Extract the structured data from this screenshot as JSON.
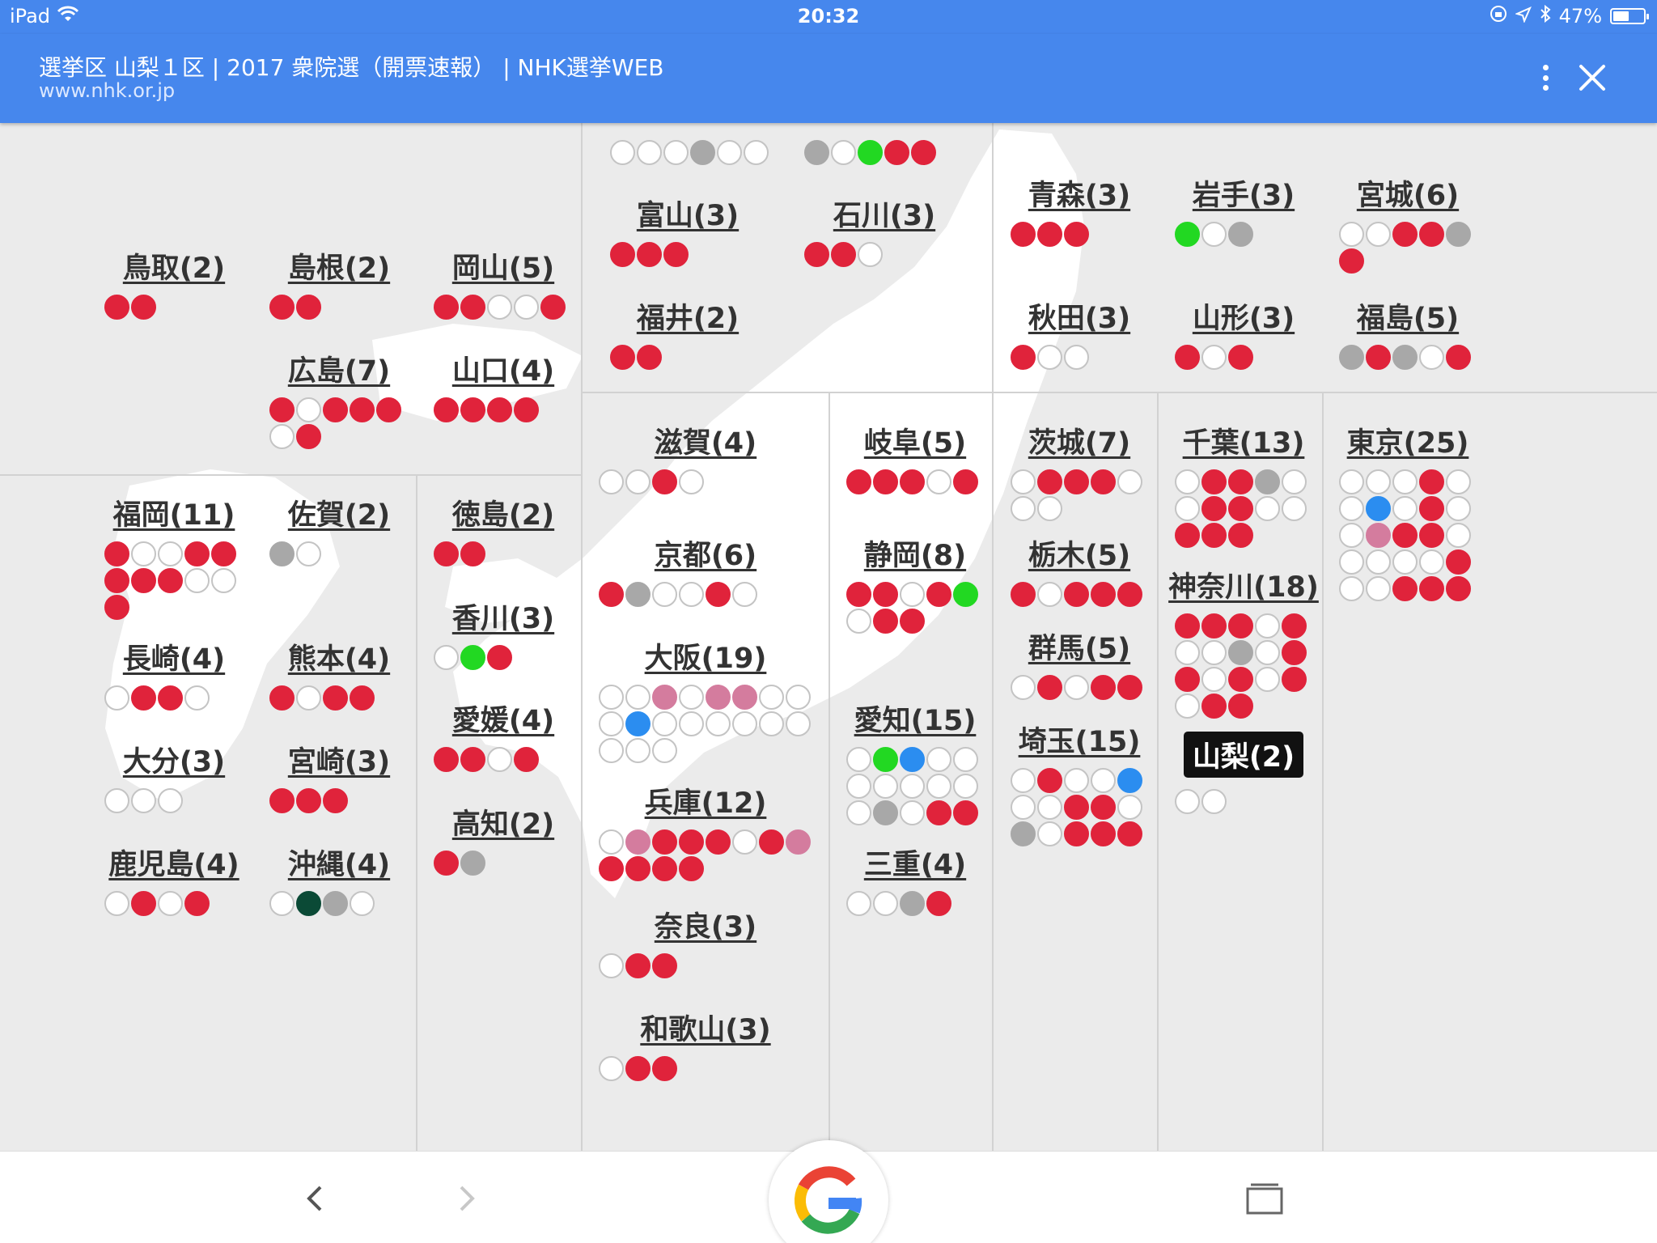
{
  "status": {
    "device": "iPad",
    "time": "20:32",
    "battery_text": "47%",
    "battery_level": 0.47
  },
  "header": {
    "title": "選挙区 山梨１区 | 2017 衆院選（開票速報） | NHK選挙WEB",
    "url": "www.nhk.or.jp"
  },
  "colors": {
    "header_bg": "#4687ed",
    "red": "#e0233b",
    "gray": "#a8a8a8",
    "green": "#22d822",
    "blue": "#2b8df0",
    "pink": "#d47c9e",
    "dark_green": "#0b4a36",
    "white": "#ffffff"
  },
  "dot_legend": {
    "r": "red",
    "g": "gray",
    "G": "green",
    "b": "blue",
    "p": "pink",
    "d": "dark-green",
    "w": "white"
  },
  "icons": {
    "menu": "more-vertical-icon",
    "close": "close-icon",
    "back": "back-arrow-icon",
    "forward": "forward-arrow-icon",
    "google": "google-logo-icon",
    "tabs": "tabs-icon",
    "scroll_top": "chevron-up-icon"
  },
  "prefectures": [
    {
      "id": "partial-1",
      "name": "",
      "dots": "wwwgww"
    },
    {
      "id": "partial-2",
      "name": "",
      "dots": "gwGrr"
    },
    {
      "id": "tottori",
      "name": "鳥取(2)",
      "dots": "rr"
    },
    {
      "id": "shimane",
      "name": "島根(2)",
      "dots": "rr"
    },
    {
      "id": "okayama",
      "name": "岡山(5)",
      "dots": "rrwwr"
    },
    {
      "id": "hiroshima",
      "name": "広島(7)",
      "dots": "rwrrrwr"
    },
    {
      "id": "yamaguchi",
      "name": "山口(4)",
      "dots": "rrrr"
    },
    {
      "id": "fukuoka",
      "name": "福岡(11)",
      "dots": "rwwrrrrrwwr"
    },
    {
      "id": "saga",
      "name": "佐賀(2)",
      "dots": "gw"
    },
    {
      "id": "tokushima",
      "name": "徳島(2)",
      "dots": "rr"
    },
    {
      "id": "kagawa",
      "name": "香川(3)",
      "dots": "wGr"
    },
    {
      "id": "nagasaki",
      "name": "長崎(4)",
      "dots": "wrrw"
    },
    {
      "id": "kumamoto",
      "name": "熊本(4)",
      "dots": "rwrr"
    },
    {
      "id": "ehime",
      "name": "愛媛(4)",
      "dots": "rrwr"
    },
    {
      "id": "oita",
      "name": "大分(3)",
      "dots": "www"
    },
    {
      "id": "miyazaki",
      "name": "宮崎(3)",
      "dots": "rrr"
    },
    {
      "id": "kochi",
      "name": "高知(2)",
      "dots": "rg"
    },
    {
      "id": "kagoshima",
      "name": "鹿児島(4)",
      "dots": "wrwr"
    },
    {
      "id": "okinawa",
      "name": "沖縄(4)",
      "dots": "wdgw"
    },
    {
      "id": "toyama",
      "name": "富山(3)",
      "dots": "rrr"
    },
    {
      "id": "ishikawa",
      "name": "石川(3)",
      "dots": "rrw"
    },
    {
      "id": "fukui",
      "name": "福井(2)",
      "dots": "rr"
    },
    {
      "id": "shiga",
      "name": "滋賀(4)",
      "dots": "wwrw"
    },
    {
      "id": "kyoto",
      "name": "京都(6)",
      "dots": "rgwwrw"
    },
    {
      "id": "osaka",
      "name": "大阪(19)",
      "dots": "wwpwppwwwbwwwwwwwww"
    },
    {
      "id": "hyogo",
      "name": "兵庫(12)",
      "dots": "wprrrwrprrrr"
    },
    {
      "id": "nara",
      "name": "奈良(3)",
      "dots": "wrr"
    },
    {
      "id": "wakayama",
      "name": "和歌山(3)",
      "dots": "wrr"
    },
    {
      "id": "gifu",
      "name": "岐阜(5)",
      "dots": "rrrwr"
    },
    {
      "id": "shizuoka",
      "name": "静岡(8)",
      "dots": "rrwrGwrr"
    },
    {
      "id": "aichi",
      "name": "愛知(15)",
      "dots": "wGbwwwwwwwwgwrr"
    },
    {
      "id": "mie",
      "name": "三重(4)",
      "dots": "wwgr"
    },
    {
      "id": "aomori",
      "name": "青森(3)",
      "dots": "rrr"
    },
    {
      "id": "iwate",
      "name": "岩手(3)",
      "dots": "Gwg"
    },
    {
      "id": "miyagi",
      "name": "宮城(6)",
      "dots": "wwrrgr"
    },
    {
      "id": "akita",
      "name": "秋田(3)",
      "dots": "rww"
    },
    {
      "id": "yamagata",
      "name": "山形(3)",
      "dots": "rwr"
    },
    {
      "id": "fukushima",
      "name": "福島(5)",
      "dots": "grgwr"
    },
    {
      "id": "ibaraki",
      "name": "茨城(7)",
      "dots": "wrrrwww"
    },
    {
      "id": "tochigi",
      "name": "栃木(5)",
      "dots": "rwrrr"
    },
    {
      "id": "gunma",
      "name": "群馬(5)",
      "dots": "wrwrr"
    },
    {
      "id": "saitama",
      "name": "埼玉(15)",
      "dots": "wrwwbwwrrwgwrrr"
    },
    {
      "id": "chiba",
      "name": "千葉(13)",
      "dots": "wrrgwwrrwwrrr"
    },
    {
      "id": "kanagawa",
      "name": "神奈川(18)",
      "dots": "rrrwrwwgwrrwrwrwrr"
    },
    {
      "id": "yamanashi",
      "name": "山梨(2)",
      "dots": "ww",
      "selected": true
    },
    {
      "id": "tokyo",
      "name": "東京(25)",
      "dots": "wwwrwwbwrwwprrwwwwwrwwrrr"
    }
  ]
}
